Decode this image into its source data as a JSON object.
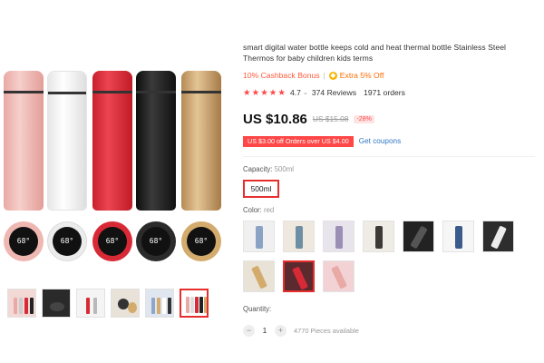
{
  "product": {
    "title": "smart digital water bottle keeps cold and heat thermal bottle Stainless Steel Thermos for baby children kids terms",
    "cashback": "10% Cashback Bonus",
    "separator": "|",
    "coin_glyph": "◆",
    "extra": "Extra 5% Off",
    "rating": {
      "stars": "★★★★★",
      "score": "4.7",
      "chevron": "⌄",
      "reviews": "374 Reviews",
      "orders": "1971 orders"
    },
    "price": "US $10.86",
    "original_price": "US $15.08",
    "discount": "-28%",
    "coupon": "US $3.00 off Orders over US $4.00",
    "get_coupons": "Get coupons",
    "capacity_label": "Capacity:",
    "capacity_value": "500ml",
    "capacity_option": "500ml",
    "color_label": "Color:",
    "color_value": "red",
    "quantity_label": "Quantity:",
    "quantity_minus": "−",
    "quantity": "1",
    "quantity_plus": "+",
    "available": "4770 Pieces available"
  },
  "gallery": {
    "display_temp": "68°",
    "bottle_colors": [
      "pink",
      "white",
      "red",
      "black",
      "gold"
    ],
    "thumbnail_count": 6,
    "active_thumbnail": 6
  },
  "colors": {
    "accent": "#e62e2e",
    "price_red": "#ff4747",
    "link_blue": "#3478c6",
    "swatch_count": 10,
    "selected_swatch": "red"
  }
}
